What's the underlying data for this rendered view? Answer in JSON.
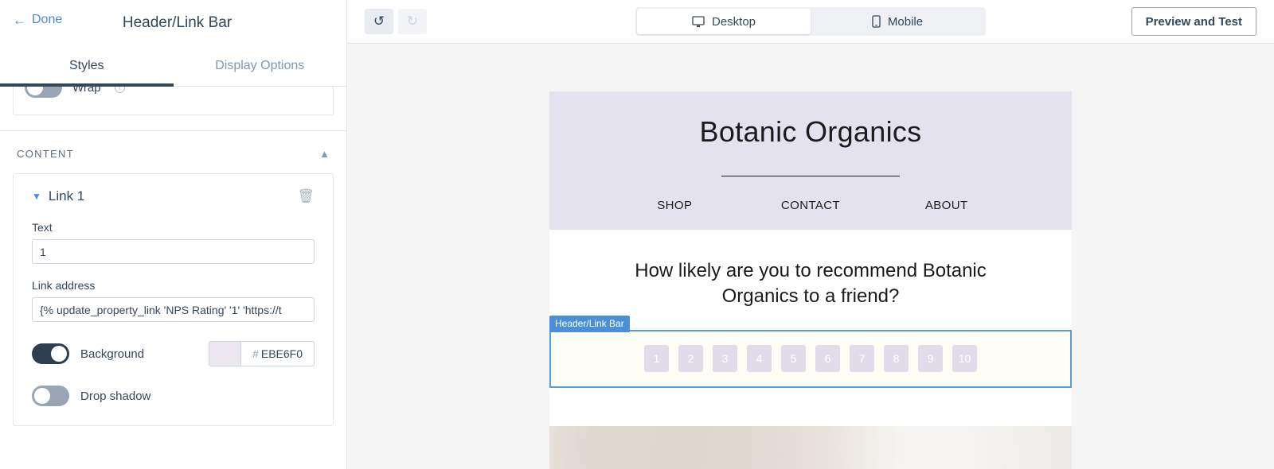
{
  "sidebar": {
    "done_label": "Done",
    "back_arrow": "←",
    "title": "Header/Link Bar",
    "tabs": [
      {
        "label": "Styles",
        "active": true
      },
      {
        "label": "Display Options",
        "active": false
      }
    ],
    "wrap_row": {
      "label": "Wrap",
      "toggle_state": "off",
      "info_icon": "i"
    },
    "content_section": {
      "title": "CONTENT",
      "collapse_icon": "chevron-up"
    },
    "link_card": {
      "expand_icon": "chevron-down",
      "name": "Link 1",
      "delete_icon": "trash",
      "text_label": "Text",
      "text_value": "1",
      "link_address_label": "Link address",
      "link_address_value": "{% update_property_link 'NPS Rating' '1' 'https://t",
      "background_label": "Background",
      "background_toggle": "on",
      "background_hash": "#",
      "background_color": "EBE6F0",
      "background_color_hex": "#EBE6F0",
      "drop_shadow_label": "Drop shadow",
      "drop_shadow_toggle": "off"
    }
  },
  "topbar": {
    "undo_icon": "↺",
    "redo_icon": "↻",
    "devices": [
      {
        "label": "Desktop",
        "icon": "monitor-icon",
        "active": true
      },
      {
        "label": "Mobile",
        "icon": "phone-icon",
        "active": false
      }
    ],
    "preview_label": "Preview and Test"
  },
  "email_preview": {
    "brand": "Botanic Organics",
    "nav": [
      "SHOP",
      "CONTACT",
      "ABOUT"
    ],
    "question": "How likely are you to recommend Botanic Organics to a friend?",
    "selection_badge": "Header/Link Bar",
    "rating_values": [
      "1",
      "2",
      "3",
      "4",
      "5",
      "6",
      "7",
      "8",
      "9",
      "10"
    ]
  },
  "float_tools": [
    {
      "icon": "duplicate-icon"
    },
    {
      "icon": "star-icon"
    },
    {
      "icon": "trash-icon"
    }
  ],
  "colors": {
    "accent_blue": "#4a8fd4",
    "selection_blue": "#4a90d9",
    "header_lavender": "#e4e2ee",
    "rating_lavender": "#e0dce9",
    "dark_text": "#33475b"
  }
}
